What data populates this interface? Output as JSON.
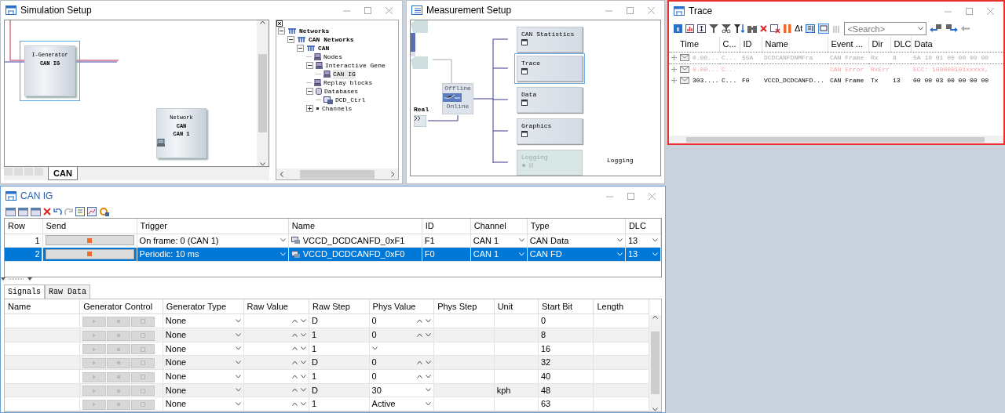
{
  "simulation_setup": {
    "title": "Simulation Setup",
    "nodes": [
      {
        "kind": "generator",
        "caption": "I-Generator",
        "name": "CAN IG",
        "selected": true
      },
      {
        "kind": "network",
        "caption": "Network",
        "name": "CAN",
        "channel": "CAN 1",
        "selected": false
      }
    ],
    "sheet_tab": "CAN",
    "tree": [
      {
        "label": "Networks",
        "kind": "network",
        "expanded": true,
        "selected": false,
        "children": [
          {
            "label": "CAN Networks",
            "kind": "network",
            "expanded": true,
            "selected": false,
            "children": [
              {
                "label": "CAN",
                "kind": "network",
                "expanded": true,
                "selected": false,
                "children": [
                  {
                    "label": "Nodes",
                    "kind": "node",
                    "selected": false
                  },
                  {
                    "label": "Interactive Gene",
                    "kind": "node",
                    "expanded": true,
                    "selected": false,
                    "children": [
                      {
                        "label": "CAN IG",
                        "kind": "node",
                        "selected": true
                      }
                    ]
                  },
                  {
                    "label": "Replay blocks",
                    "kind": "node",
                    "selected": false
                  },
                  {
                    "label": "Databases",
                    "kind": "database",
                    "expanded": true,
                    "selected": false,
                    "children": [
                      {
                        "label": "DCD_Ctrl",
                        "kind": "dbc",
                        "selected": false
                      }
                    ]
                  },
                  {
                    "label": "Channels",
                    "kind": "channel",
                    "expanded": false,
                    "selected": false
                  }
                ]
              }
            ]
          }
        ]
      }
    ]
  },
  "measurement_setup": {
    "title": "Measurement Setup",
    "source": "Real",
    "switch_offline": "Offline",
    "switch_online": "Online",
    "online": false,
    "blocks": [
      {
        "label": "CAN Statistics",
        "selected": false,
        "disabled": false
      },
      {
        "label": "Trace",
        "selected": true,
        "disabled": false
      },
      {
        "label": "Data",
        "selected": false,
        "disabled": false
      },
      {
        "label": "Graphics",
        "selected": false,
        "disabled": false
      },
      {
        "label": "Logging",
        "selected": false,
        "disabled": true
      }
    ],
    "logging_file": "Logging"
  },
  "trace": {
    "title": "Trace",
    "delta_button": "Δt",
    "search": {
      "placeholder": "<Search>"
    },
    "columns": [
      "Time",
      "C...",
      "ID",
      "Name",
      "Event ...",
      "Dir",
      "DLC",
      "Data"
    ],
    "rows": [
      {
        "kind": "frame",
        "disabled": true,
        "selected": true,
        "cells": [
          "0.00...",
          "C...",
          "55A",
          "DCDCANFDNMFra",
          "CAN Frame",
          "Rx",
          "8",
          "5A 10 01 00 00 00 00"
        ]
      },
      {
        "kind": "error",
        "disabled": true,
        "selected": false,
        "cells": [
          "0.00...",
          "C...",
          "",
          "",
          "CAN Error",
          "RxErr",
          "",
          "ECC: 100000101xxxxx,"
        ]
      },
      {
        "kind": "frame",
        "disabled": false,
        "selected": false,
        "cells": [
          "303....",
          "C...",
          "F0",
          "VCCD_DCDCANFD...",
          "CAN Frame",
          "Tx",
          "13",
          "00 00 03 00 00 00 00"
        ]
      }
    ]
  },
  "can_ig": {
    "title": "CAN IG",
    "columns": [
      "Row",
      "Send",
      "Trigger",
      "Name",
      "ID",
      "Channel",
      "Type",
      "DLC"
    ],
    "rows": [
      {
        "row": "1",
        "trigger": "On frame: 0 (CAN 1)",
        "name": "VCCD_DCDCANFD_0xF1",
        "id": "F1",
        "channel": "CAN 1",
        "type": "CAN Data",
        "dlc": "13",
        "selected": false
      },
      {
        "row": "2",
        "trigger": "Periodic: 10 ms",
        "name": "VCCD_DCDCANFD_0xF0",
        "id": "F0",
        "channel": "CAN 1",
        "type": "CAN FD",
        "dlc": "13",
        "selected": true
      }
    ],
    "tabs": [
      {
        "label": "Signals",
        "selected": true
      },
      {
        "label": "Raw Data",
        "selected": false
      }
    ],
    "signal_columns": [
      "Name",
      "Generator Control",
      "Generator Type",
      "Raw Value",
      "Raw Step",
      "Phys Value",
      "Phys Step",
      "Unit",
      "Start Bit",
      "Length"
    ],
    "signals": [
      {
        "kind": "spin",
        "generator_type": "None",
        "raw_step": "D",
        "phys_value": "0",
        "start_bit": "0"
      },
      {
        "kind": "spin",
        "generator_type": "None",
        "raw_step": "1",
        "phys_value": "0",
        "start_bit": "8"
      },
      {
        "kind": "list",
        "generator_type": "None",
        "raw_step": "1",
        "start_bit": "16"
      },
      {
        "kind": "spin",
        "generator_type": "None",
        "raw_step": "D",
        "phys_value": "0",
        "start_bit": "32"
      },
      {
        "kind": "spin",
        "generator_type": "None",
        "raw_step": "1",
        "phys_value": "0",
        "start_bit": "40"
      },
      {
        "kind": "list",
        "generator_type": "None",
        "raw_step": "D",
        "phys_value": "30",
        "unit": "kph",
        "start_bit": "48"
      },
      {
        "kind": "list",
        "generator_type": "None",
        "raw_step": "1",
        "phys_value": "Active",
        "start_bit": "63"
      }
    ]
  }
}
